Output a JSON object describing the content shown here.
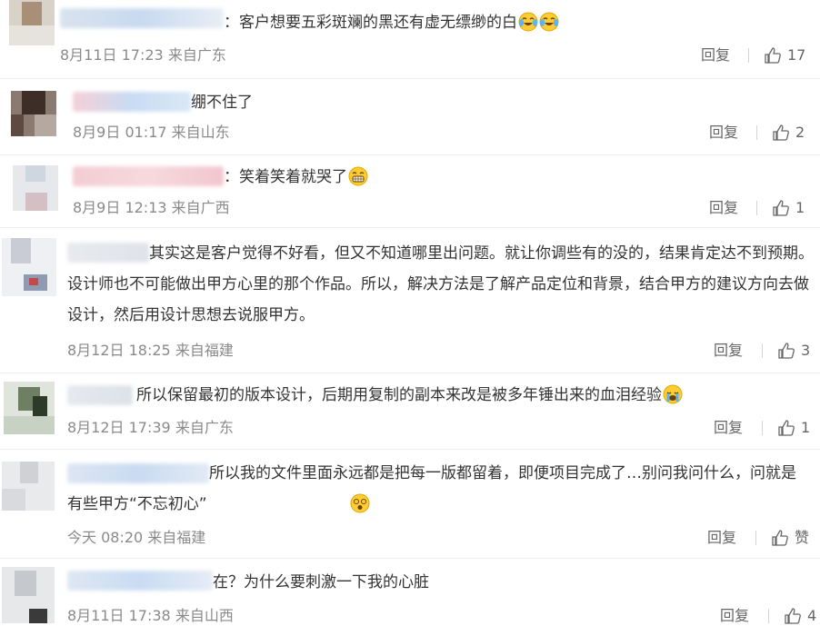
{
  "comments": [
    {
      "text": "：客户想要五彩斑斓的黑还有虚无缥缈的白",
      "emoji": [
        "cry-laugh",
        "cry-laugh"
      ],
      "time": "8月11日 17:23",
      "location": "来自广东",
      "reply": "回复",
      "likes": "17"
    },
    {
      "text": "绷不住了",
      "emoji": [],
      "time": "8月9日 01:17",
      "location": "来自山东",
      "reply": "回复",
      "likes": "2"
    },
    {
      "text": "：笑着笑着就哭了",
      "emoji": [
        "grin"
      ],
      "time": "8月9日 12:13",
      "location": "来自广西",
      "reply": "回复",
      "likes": "1"
    },
    {
      "text": "其实这是客户觉得不好看，但又不知道哪里出问题。就让你调些有的没的，结果肯定达不到预期。设计师也不可能做出甲方心里的那个作品。所以，解决方法是了解产品定位和背景，结合甲方的建议方向去做设计，然后用设计思想去说服甲方。",
      "emoji": [],
      "time": "8月12日 18:25",
      "location": "来自福建",
      "reply": "回复",
      "likes": "3"
    },
    {
      "text": "所以保留最初的版本设计，后期用复制的副本来改是被多年锤出来的血泪经验",
      "emoji": [
        "sob"
      ],
      "time": "8月12日 17:39",
      "location": "来自广东",
      "reply": "回复",
      "likes": "1"
    },
    {
      "text": "所以我的文件里面永远都是把每一版都留着，即便项目完成了…别问我问什么，问就是有些甲方“不忘初心”",
      "emoji": [
        "dizzy"
      ],
      "time": "今天 08:20",
      "location": "来自福建",
      "reply": "回复",
      "likes": "赞"
    },
    {
      "text": "在？为什么要刺激一下我的心脏",
      "emoji": [],
      "time": "8月11日 17:38",
      "location": "来自山西",
      "reply": "回复",
      "likes": "4"
    }
  ]
}
